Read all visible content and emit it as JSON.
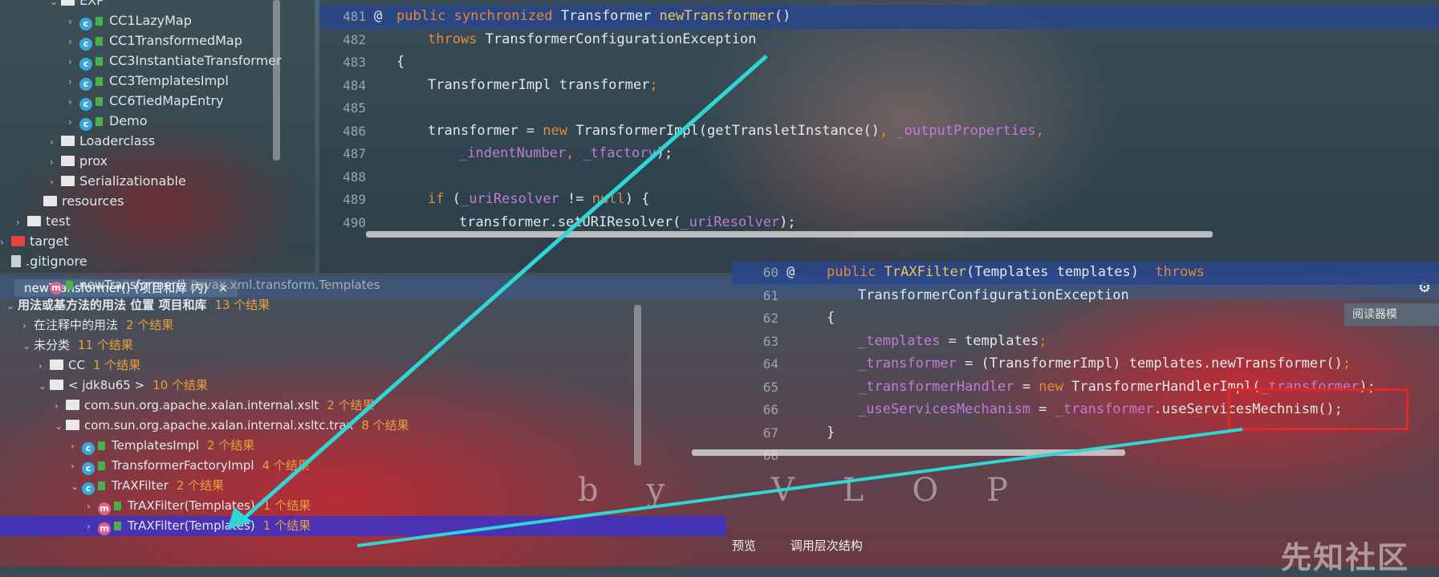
{
  "tree": {
    "items": [
      {
        "label": "EXP",
        "indent": 62,
        "kind": "folder",
        "arrow": "⌄"
      },
      {
        "label": "CC1LazyMap",
        "indent": 85,
        "kind": "class",
        "arrow": "›"
      },
      {
        "label": "CC1TransformedMap",
        "indent": 85,
        "kind": "class",
        "arrow": "›"
      },
      {
        "label": "CC3InstantiateTransformer",
        "indent": 85,
        "kind": "class",
        "arrow": "›"
      },
      {
        "label": "CC3TemplatesImpl",
        "indent": 85,
        "kind": "class",
        "arrow": "›"
      },
      {
        "label": "CC6TiedMapEntry",
        "indent": 85,
        "kind": "class",
        "arrow": "›"
      },
      {
        "label": "Demo",
        "indent": 85,
        "kind": "class",
        "arrow": "›"
      },
      {
        "label": "Loaderclass",
        "indent": 62,
        "kind": "folder",
        "arrow": "›"
      },
      {
        "label": "prox",
        "indent": 62,
        "kind": "folder",
        "arrow": "›"
      },
      {
        "label": "Serializationable",
        "indent": 62,
        "kind": "folder",
        "arrow": "›"
      },
      {
        "label": "resources",
        "indent": 40,
        "kind": "folder",
        "arrow": ""
      },
      {
        "label": "test",
        "indent": 20,
        "kind": "folder",
        "arrow": "›"
      },
      {
        "label": "target",
        "indent": 0,
        "kind": "folder-red",
        "arrow": "›"
      },
      {
        "label": ".gitignore",
        "indent": 0,
        "kind": "file",
        "arrow": ""
      }
    ]
  },
  "editor_top": {
    "lines": [
      {
        "num": "481",
        "segments": [
          {
            "t": "public synchronized ",
            "c": "kw"
          },
          {
            "t": "Transformer ",
            "c": "plain"
          },
          {
            "t": "newTransformer",
            "c": "fn"
          },
          {
            "t": "()",
            "c": "plain"
          }
        ],
        "indent": 0,
        "marker": "@"
      },
      {
        "num": "482",
        "segments": [
          {
            "t": "throws ",
            "c": "kw"
          },
          {
            "t": "TransformerConfigurationException",
            "c": "plain"
          }
        ],
        "indent": 1,
        "marker": ""
      },
      {
        "num": "483",
        "segments": [
          {
            "t": "{",
            "c": "plain"
          }
        ],
        "indent": 0,
        "marker": ""
      },
      {
        "num": "484",
        "segments": [
          {
            "t": "TransformerImpl transformer",
            "c": "plain"
          },
          {
            "t": ";",
            "c": "kw"
          }
        ],
        "indent": 1,
        "marker": ""
      },
      {
        "num": "485",
        "segments": [],
        "indent": 0,
        "marker": ""
      },
      {
        "num": "486",
        "segments": [
          {
            "t": "transformer = ",
            "c": "plain"
          },
          {
            "t": "new ",
            "c": "kw"
          },
          {
            "t": "TransformerImpl(getTransletInstance()",
            "c": "plain"
          },
          {
            "t": ", ",
            "c": "kw"
          },
          {
            "t": "_outputProperties",
            "c": "fld"
          },
          {
            "t": ",",
            "c": "kw"
          }
        ],
        "indent": 1,
        "marker": ""
      },
      {
        "num": "487",
        "segments": [
          {
            "t": "_indentNumber",
            "c": "fld"
          },
          {
            "t": ", ",
            "c": "kw"
          },
          {
            "t": "_tfactory",
            "c": "fld"
          },
          {
            "t": ");",
            "c": "plain"
          }
        ],
        "indent": 2,
        "marker": ""
      },
      {
        "num": "488",
        "segments": [],
        "indent": 0,
        "marker": ""
      },
      {
        "num": "489",
        "segments": [
          {
            "t": "if ",
            "c": "kw"
          },
          {
            "t": "(",
            "c": "plain"
          },
          {
            "t": "_uriResolver",
            "c": "fld"
          },
          {
            "t": " != ",
            "c": "plain"
          },
          {
            "t": "null",
            "c": "kw"
          },
          {
            "t": ") {",
            "c": "plain"
          }
        ],
        "indent": 1,
        "marker": ""
      },
      {
        "num": "490",
        "segments": [
          {
            "t": "transformer.setURIResolver(",
            "c": "plain"
          },
          {
            "t": "_uriResolver",
            "c": "fld"
          },
          {
            "t": ");",
            "c": "plain"
          }
        ],
        "indent": 2,
        "marker": ""
      }
    ]
  },
  "find": {
    "tab_label": "newTransformer() (项目和库 内)",
    "close_glyph": "×",
    "settings_glyph": "⚙",
    "reader_mode": "阅读器模",
    "rows": [
      {
        "label": "newTransformer()",
        "extra": " /javax.xml.transform.Templates",
        "count": "",
        "indent": 48,
        "kind": "method",
        "arrow": ""
      },
      {
        "label": "用法或基方法的用法 位置 项目和库",
        "extra": "",
        "count": "13 个结果",
        "indent": 8,
        "kind": "none",
        "arrow": "⌄",
        "bold": true
      },
      {
        "label": "在注释中的用法",
        "extra": "",
        "count": "2 个结果",
        "indent": 28,
        "kind": "none",
        "arrow": "›"
      },
      {
        "label": "未分类",
        "extra": "",
        "count": "11 个结果",
        "indent": 28,
        "kind": "none",
        "arrow": "⌄"
      },
      {
        "label": "CC",
        "extra": "",
        "count": "1 个结果",
        "indent": 48,
        "kind": "folder",
        "arrow": "›"
      },
      {
        "label": "< jdk8u65 >",
        "extra": "",
        "count": "10 个结果",
        "indent": 48,
        "kind": "folder",
        "arrow": "⌄"
      },
      {
        "label": "com.sun.org.apache.xalan.internal.xslt",
        "extra": "",
        "count": "2 个结果",
        "indent": 68,
        "kind": "folder",
        "arrow": "›"
      },
      {
        "label": "com.sun.org.apache.xalan.internal.xsltc.trax",
        "extra": "",
        "count": "8 个结果",
        "indent": 68,
        "kind": "folder",
        "arrow": "⌄"
      },
      {
        "label": "TemplatesImpl",
        "extra": "",
        "count": "2 个结果",
        "indent": 88,
        "kind": "class",
        "arrow": "›"
      },
      {
        "label": "TransformerFactoryImpl",
        "extra": "",
        "count": "4 个结果",
        "indent": 88,
        "kind": "class",
        "arrow": "›"
      },
      {
        "label": "TrAXFilter",
        "extra": "",
        "count": "2 个结果",
        "indent": 88,
        "kind": "class",
        "arrow": "⌄"
      },
      {
        "label": "TrAXFilter(Templates)",
        "extra": "",
        "count": "1 个结果",
        "indent": 108,
        "kind": "method",
        "arrow": "›"
      },
      {
        "label": "TrAXFilter(Templates)",
        "extra": "",
        "count": "1 个结果",
        "indent": 108,
        "kind": "method",
        "arrow": "›",
        "selected": true
      }
    ]
  },
  "editor_bottom": {
    "lines": [
      {
        "num": "60",
        "segments": [
          {
            "t": "public ",
            "c": "kw"
          },
          {
            "t": "TrAXFilter",
            "c": "fn"
          },
          {
            "t": "(Templates templates)  ",
            "c": "plain"
          },
          {
            "t": "throws",
            "c": "kw"
          }
        ],
        "indent": 0,
        "marker": "@"
      },
      {
        "num": "61",
        "segments": [
          {
            "t": "TransformerConfigurationException",
            "c": "plain"
          }
        ],
        "indent": 1,
        "marker": ""
      },
      {
        "num": "62",
        "segments": [
          {
            "t": "{",
            "c": "plain"
          }
        ],
        "indent": 0,
        "marker": ""
      },
      {
        "num": "63",
        "segments": [
          {
            "t": "_templates",
            "c": "fld"
          },
          {
            "t": " = templates",
            "c": "plain"
          },
          {
            "t": ";",
            "c": "kw"
          }
        ],
        "indent": 1,
        "marker": ""
      },
      {
        "num": "64",
        "segments": [
          {
            "t": "_transformer",
            "c": "fld"
          },
          {
            "t": " = (TransformerImpl) templates.newTransformer()",
            "c": "plain"
          },
          {
            "t": ";",
            "c": "kw"
          }
        ],
        "indent": 1,
        "marker": ""
      },
      {
        "num": "65",
        "segments": [
          {
            "t": "_transformerHandler",
            "c": "fld"
          },
          {
            "t": " = ",
            "c": "plain"
          },
          {
            "t": "new ",
            "c": "kw"
          },
          {
            "t": "TransformerHandlerImpl(",
            "c": "plain"
          },
          {
            "t": "_transformer",
            "c": "fld"
          },
          {
            "t": ");",
            "c": "plain"
          }
        ],
        "indent": 1,
        "marker": ""
      },
      {
        "num": "66",
        "segments": [
          {
            "t": "_useServicesMechanism",
            "c": "fld"
          },
          {
            "t": " = ",
            "c": "plain"
          },
          {
            "t": "_transformer",
            "c": "fld"
          },
          {
            "t": ".useServicesMechnism();",
            "c": "plain"
          }
        ],
        "indent": 1,
        "marker": ""
      },
      {
        "num": "67",
        "segments": [
          {
            "t": "}",
            "c": "plain"
          }
        ],
        "indent": 0,
        "marker": ""
      },
      {
        "num": "68",
        "segments": [],
        "indent": 0,
        "marker": ""
      }
    ],
    "tabs": [
      "预览",
      "调用层次结构"
    ]
  },
  "wallpaper_text": "by VLOP",
  "watermark": "先知社区",
  "colors": {
    "highlight": "#284690",
    "selection": "#3c32c8",
    "annotation_box": "#e02828",
    "arrow": "#2fd6d6"
  }
}
